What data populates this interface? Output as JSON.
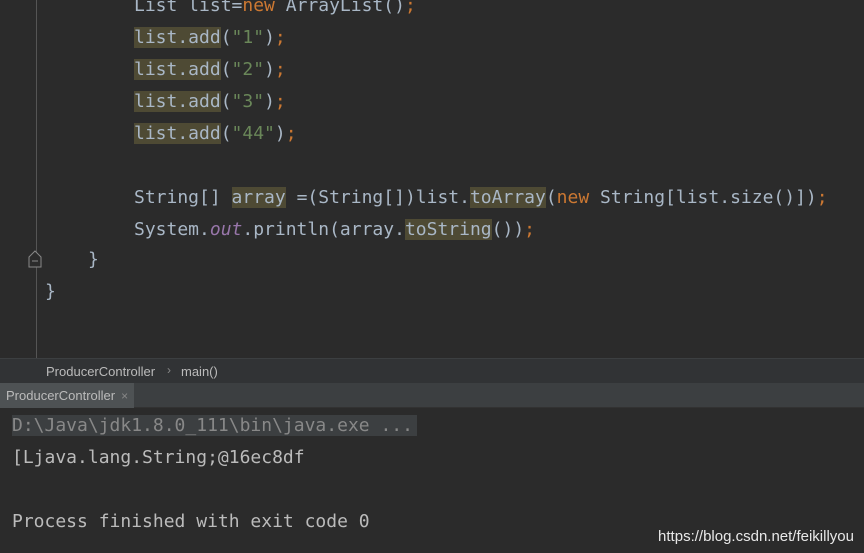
{
  "editor": {
    "lines": {
      "l0": {
        "a": "List list=",
        "b": "new",
        "c": " ArrayList()",
        "d": ";"
      },
      "l1": {
        "a": "list.add",
        "b": "(",
        "c": "\"1\"",
        "d": ")",
        "e": ";"
      },
      "l2": {
        "a": "list.add",
        "b": "(",
        "c": "\"2\"",
        "d": ")",
        "e": ";"
      },
      "l3": {
        "a": "list.add",
        "b": "(",
        "c": "\"3\"",
        "d": ")",
        "e": ";"
      },
      "l4": {
        "a": "list.add",
        "b": "(",
        "c": "\"44\"",
        "d": ")",
        "e": ";"
      },
      "l5": {
        "a": "String[] ",
        "b": "array",
        "c": " =(String[])list.",
        "d": "toArray",
        "e": "(",
        "f": "new",
        "g": " String[list.size()])",
        "h": ";"
      },
      "l6": {
        "a": "System.",
        "b": "out",
        "c": ".println(array.",
        "d": "toString",
        "e": "())",
        "f": ";"
      },
      "l7": {
        "a": "}"
      },
      "l8": {
        "a": "}"
      }
    }
  },
  "breadcrumb": {
    "file": "ProducerController",
    "separator": "›",
    "method": "main()"
  },
  "run_panel": {
    "tab_label": "ProducerController",
    "tab_close": "×"
  },
  "console": {
    "command": "D:\\Java\\jdk1.8.0_111\\bin\\java.exe ...",
    "output": "[Ljava.lang.String;@16ec8df",
    "exit_message": "Process finished with exit code 0"
  },
  "watermark": "https://blog.csdn.net/feikillyou"
}
